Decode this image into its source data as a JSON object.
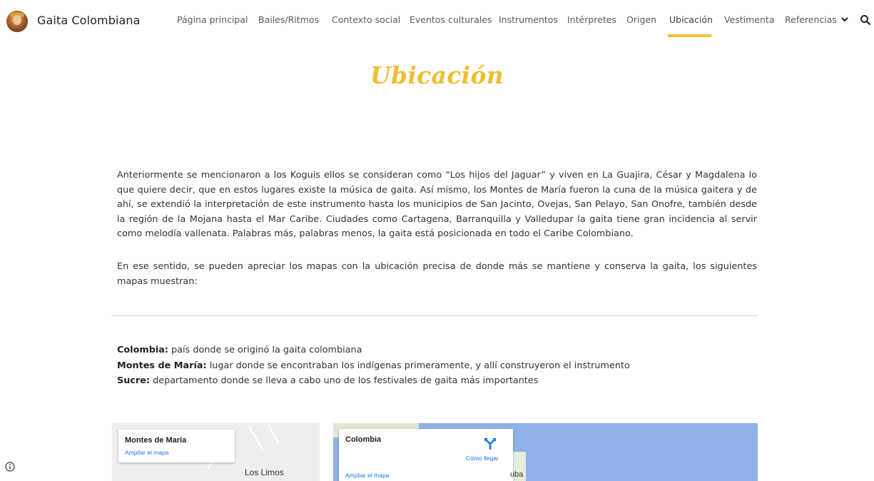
{
  "site": {
    "title": "Gaita Colombiana"
  },
  "nav": {
    "items": [
      {
        "label": "Página principal"
      },
      {
        "label": "Bailes/Ritmos"
      },
      {
        "label": "Contexto social"
      },
      {
        "label": "Eventos culturales"
      },
      {
        "label": "Instrumentos"
      },
      {
        "label": "Intérpretes"
      },
      {
        "label": "Origen"
      },
      {
        "label": "Ubicación",
        "active": true
      },
      {
        "label": "Vestimenta"
      },
      {
        "label": "Referencias",
        "has_dropdown": true
      }
    ],
    "accent_color": "#f2c12e"
  },
  "page": {
    "title": "Ubicación",
    "title_color": "#efbd2f",
    "paragraphs": [
      "Anteriormente se mencionaron a los Koguis ellos se consideran como “Los hijos del Jaguar” y viven en La Guajira, César y Magdalena lo que quiere decir, que en estos lugares existe la música de gaita. Así mismo, los Montes de María fueron la cuna de la música gaitera y de ahí, se extendió la interpretación de este instrumento hasta los municipios de San Jacinto, Ovejas, San Pelayo, San Onofre, también desde la región de la Mojana hasta el Mar Caribe. Ciudades como Cartagena, Barranquilla y Valledupar la gaita tiene gran incidencia al servir como melodía vallenata. Palabras más, palabras menos, la gaita está posicionada en todo el Caribe Colombiano.",
      "En ese sentido, se pueden apreciar los mapas con la ubicación precisa de donde más se mantiene y conserva la gaita, los siguientes mapas muestran:"
    ],
    "legend": [
      {
        "term": "Colombia:",
        "desc": " país donde se originó la gaita colombiana"
      },
      {
        "term": "Montes de María:",
        "desc": " lugar donde se encontraban los indígenas primeramente, y allí construyeron el instrumento"
      },
      {
        "term": "Sucre:",
        "desc": " departamento donde se lleva a cabo uno de los festivales de gaita más importantes"
      }
    ]
  },
  "maps": [
    {
      "title": "Montes de María",
      "enlarge_link": "Ampliar el mapa",
      "place_label": "Los Limos"
    },
    {
      "title": "Colombia",
      "enlarge_link": "Ampliar el mapa",
      "route_link": "Cómo llegar",
      "place_label": "uba"
    }
  ],
  "icons": {
    "search": "search-icon",
    "dropdown": "chevron-down-icon",
    "info": "info-icon",
    "route": "directions-icon"
  }
}
